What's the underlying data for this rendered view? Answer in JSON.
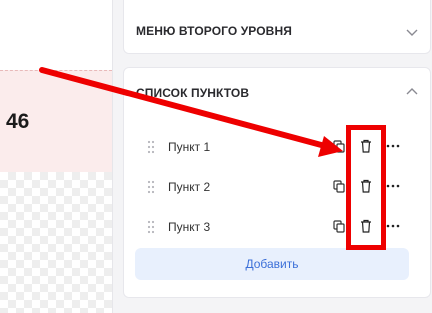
{
  "canvas": {
    "value": "46"
  },
  "panel": {
    "level2_title": "МЕНЮ ВТОРОГО УРОВНЯ",
    "list_title": "СПИСОК ПУНКТОВ",
    "items": [
      {
        "label": "Пункт 1"
      },
      {
        "label": "Пункт 2"
      },
      {
        "label": "Пункт 3"
      }
    ],
    "add_label": "Добавить"
  },
  "icons": {
    "level2_toggle": "chevron-down-icon",
    "list_toggle": "chevron-up-icon",
    "row_icons": [
      "drag-handle-icon",
      "copy-icon",
      "trash-icon",
      "more-icon"
    ]
  },
  "colors": {
    "annotation": "#ee0000",
    "accent": "#3b6fd8",
    "add_button_bg": "#e8f0fd"
  }
}
